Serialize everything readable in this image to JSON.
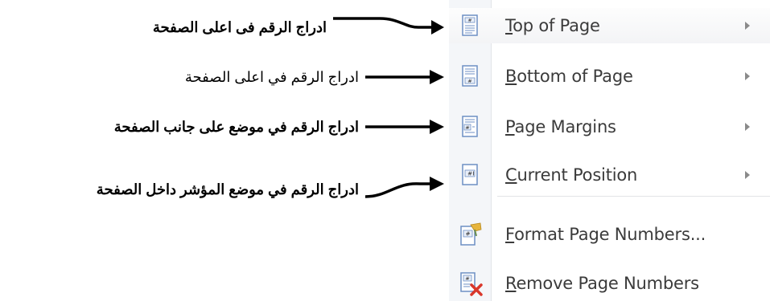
{
  "annotations": [
    {
      "text": "ادراج الرقم فى اعلى الصفحة",
      "bold": true
    },
    {
      "text": "ادراج الرقم في اعلى الصفحة",
      "bold": false
    },
    {
      "text": "ادراج الرقم في موضع على جانب الصفحة",
      "bold": true
    },
    {
      "text": "ادراج الرقم في موضع المؤشر داخل الصفحة",
      "bold": true
    }
  ],
  "menu": {
    "items": [
      {
        "accel": "T",
        "rest": "op of Page",
        "icon": "top-of-page-icon",
        "submenu": true
      },
      {
        "accel": "B",
        "rest": "ottom of Page",
        "icon": "bottom-of-page-icon",
        "submenu": true
      },
      {
        "accel": "P",
        "rest": "age Margins",
        "icon": "page-margins-icon",
        "submenu": true
      },
      {
        "accel": "C",
        "rest": "urrent Position",
        "icon": "current-position-icon",
        "submenu": true
      },
      {
        "accel": "F",
        "rest": "ormat Page Numbers...",
        "icon": "format-page-numbers-icon",
        "submenu": false
      },
      {
        "accel": "R",
        "rest": "emove Page Numbers",
        "icon": "remove-page-numbers-icon",
        "submenu": false
      }
    ]
  },
  "colors": {
    "accent_gold": "#e7b53d",
    "remove_red": "#d9372b",
    "page_blue": "#6d8fc4"
  }
}
